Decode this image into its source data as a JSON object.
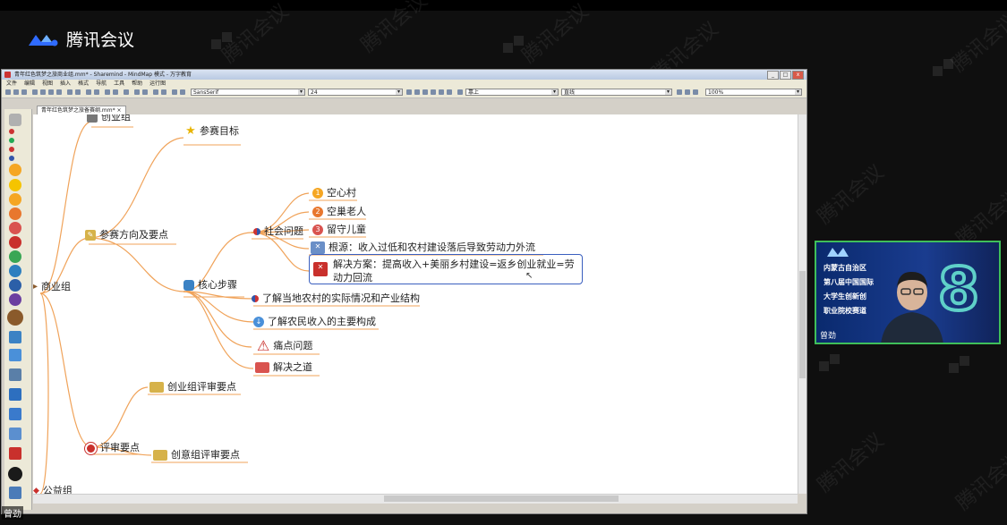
{
  "app": {
    "name": "腾讯会议",
    "watermark": "腾讯会议"
  },
  "window": {
    "title": "青年红色筑梦之旅商业组.mm* - Sharemind - MindMap 模式 - 万字教育",
    "menus": [
      "文件",
      "编辑",
      "视图",
      "插入",
      "格式",
      "导航",
      "工具",
      "帮助",
      "运行图"
    ],
    "toolbar": {
      "font": "SansSerif",
      "size": "24",
      "combo3": "靠上",
      "combo4": "直线",
      "zoom": "100%"
    },
    "doc_tab": "青年红色筑梦之旅备赛纲.mm*"
  },
  "mindmap": {
    "top_cut": "创业组",
    "root": "商业组",
    "branch1": "参赛方向及要点",
    "goal": "参赛目标",
    "core": "核心步骤",
    "social": "社会问题",
    "social_items": [
      "空心村",
      "空巢老人",
      "留守儿童"
    ],
    "root_cause": "根源：收入过低和农村建设落后导致劳动力外流",
    "solution": "解决方案：提高收入+美丽乡村建设=返乡创业就业=劳动力回流",
    "understand1": "了解当地农村的实际情况和产业结构",
    "understand2": "了解农民收入的主要构成",
    "pain": "痛点问题",
    "resolve": "解决之道",
    "review": "评审要点",
    "review1": "创业组评审要点",
    "review2": "创意组评审要点",
    "bottom": "公益组"
  },
  "camera": {
    "banner": [
      "内蒙古自治区",
      "第八届中国国际",
      "大学生创新创",
      "职业院校赛道"
    ],
    "big_number": "8",
    "name": "曾劲"
  },
  "local_user": "曾劲",
  "colors": {
    "accent_green": "#3fbf5a",
    "selection_blue": "#3a5fbf",
    "link_orange": "#f0a35a"
  }
}
